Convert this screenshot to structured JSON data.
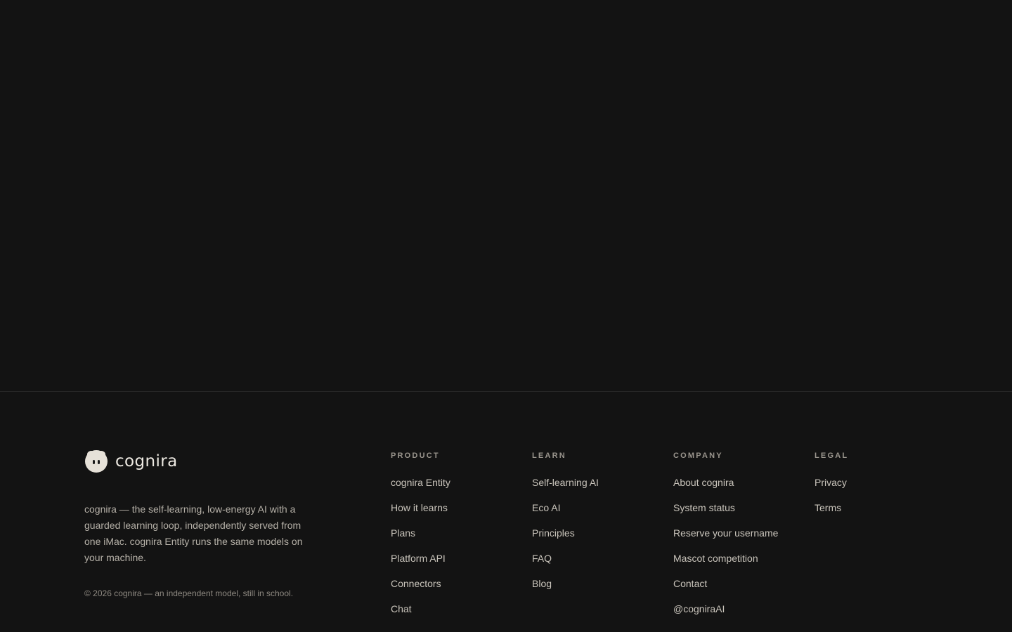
{
  "brand": {
    "name": "cognira",
    "tagline": "cognira — the self-learning, low-energy AI with a guarded learning loop, independently served from one iMac. cognira Entity runs the same models on your machine.",
    "copyright": "© 2026 cognira — an independent model, still in school."
  },
  "footer": {
    "columns": [
      {
        "heading": "PRODUCT",
        "links": [
          "cognira Entity",
          "How it learns",
          "Plans",
          "Platform API",
          "Connectors",
          "Chat"
        ]
      },
      {
        "heading": "LEARN",
        "links": [
          "Self-learning AI",
          "Eco AI",
          "Principles",
          "FAQ",
          "Blog"
        ]
      },
      {
        "heading": "COMPANY",
        "links": [
          "About cognira",
          "System status",
          "Reserve your username",
          "Mascot competition",
          "Contact",
          "@cogniraAI"
        ]
      },
      {
        "heading": "LEGAL",
        "links": [
          "Privacy",
          "Terms"
        ]
      }
    ]
  },
  "icons": {
    "logo": "mascot-icon"
  },
  "colors": {
    "background": "#131313",
    "text": "#c9c4bb",
    "muted": "#9a958d"
  }
}
